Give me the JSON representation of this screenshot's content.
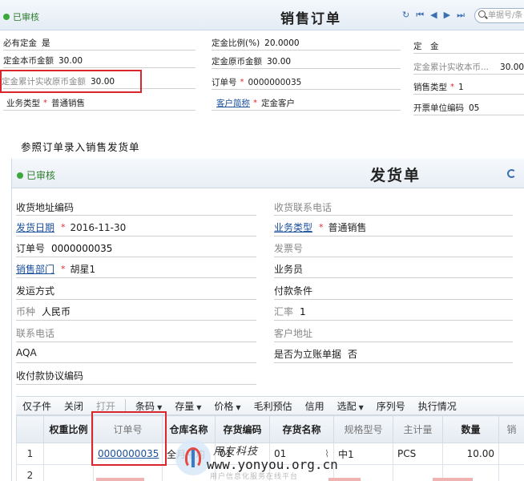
{
  "top_form": {
    "status": "已审核",
    "title": "销售订单",
    "search_placeholder": "单据号/条",
    "fields": {
      "deposit_required": {
        "label": "必有定金",
        "value": "是"
      },
      "deposit_ratio": {
        "label": "定金比例(%)",
        "value": "20.0000"
      },
      "deposit": {
        "label": "定　金",
        "value": ""
      },
      "deposit_local_amount": {
        "label": "定金本币金额",
        "value": "30.00"
      },
      "deposit_orig_amount": {
        "label": "定金原币金额",
        "value": "30.00"
      },
      "deposit_cum_local": {
        "label": "定金累计实收本币...",
        "value": "30.00"
      },
      "deposit_cum_orig": {
        "label": "定金累计实收原币金额",
        "value": "30.00"
      },
      "order_no": {
        "label": "订单号",
        "value": "0000000035"
      },
      "sales_type": {
        "label": "销售类型",
        "value": "1"
      },
      "business_type": {
        "label": "业务类型",
        "value": "普通销售"
      },
      "customer_short": {
        "label": "客户简称",
        "value": "定金客户"
      },
      "invoice_unit_code": {
        "label": "开票单位编码",
        "value": "05"
      }
    }
  },
  "caption": "参照订单录入销售发货单",
  "delivery": {
    "status": "已审核",
    "title": "发货单",
    "fields": {
      "ship_address_code": {
        "label": "收货地址编码",
        "value": ""
      },
      "receiver_phone": {
        "label": "收货联系电话",
        "value": ""
      },
      "ship_date": {
        "label": "发货日期",
        "value": "2016-11-30"
      },
      "business_type": {
        "label": "业务类型",
        "value": "普通销售"
      },
      "order_no": {
        "label": "订单号",
        "value": "0000000035"
      },
      "invoice_no": {
        "label": "发票号",
        "value": ""
      },
      "sales_dept": {
        "label": "销售部门",
        "value": "胡星1"
      },
      "salesperson": {
        "label": "业务员",
        "value": ""
      },
      "ship_method": {
        "label": "发运方式",
        "value": ""
      },
      "payment_terms": {
        "label": "付款条件",
        "value": ""
      },
      "currency": {
        "label": "币种",
        "value": "人民币"
      },
      "exchange_rate": {
        "label": "汇率",
        "value": "1"
      },
      "contact_phone": {
        "label": "联系电话",
        "value": ""
      },
      "customer_address": {
        "label": "客户地址",
        "value": ""
      },
      "aqa": {
        "label": "AQA",
        "value": ""
      },
      "is_immediate_account": {
        "label": "是否为立账单据",
        "value": "否"
      },
      "payment_agreement_code": {
        "label": "收付款协议编码",
        "value": ""
      }
    },
    "toolbar": [
      {
        "label": "仅子件",
        "dim": false,
        "dropdown": false
      },
      {
        "label": "关闭",
        "dim": false,
        "dropdown": false
      },
      {
        "label": "打开",
        "dim": true,
        "dropdown": false
      },
      {
        "label": "条码",
        "dim": false,
        "dropdown": true
      },
      {
        "label": "存量",
        "dim": false,
        "dropdown": true
      },
      {
        "label": "价格",
        "dim": false,
        "dropdown": true
      },
      {
        "label": "毛利预估",
        "dim": false,
        "dropdown": false
      },
      {
        "label": "信用",
        "dim": false,
        "dropdown": false
      },
      {
        "label": "选配",
        "dim": false,
        "dropdown": true
      },
      {
        "label": "序列号",
        "dim": false,
        "dropdown": false
      },
      {
        "label": "执行情况",
        "dim": false,
        "dropdown": false
      }
    ],
    "grid": {
      "columns": [
        "",
        "权重比例",
        "订单号",
        "仓库名称",
        "存货编码",
        "存货名称",
        "规格型号",
        "主计量",
        "数量",
        "销"
      ],
      "rows": [
        [
          "1",
          "",
          "0000000035",
          "全月平均",
          "01",
          "01",
          "中1",
          "PCS",
          "10.00",
          ""
        ],
        [
          "2",
          "",
          "",
          "",
          "",
          "",
          "",
          "",
          "",
          ""
        ]
      ]
    }
  },
  "watermark": {
    "cn": "用友科技",
    "url": "www.yonyou.org.cn",
    "tag": "用户信息化服务在线平台"
  },
  "colors": {
    "highlight": "#d9262c",
    "link": "#1a4f9c",
    "status_green": "#3aa83a",
    "required": "#e0292f"
  }
}
